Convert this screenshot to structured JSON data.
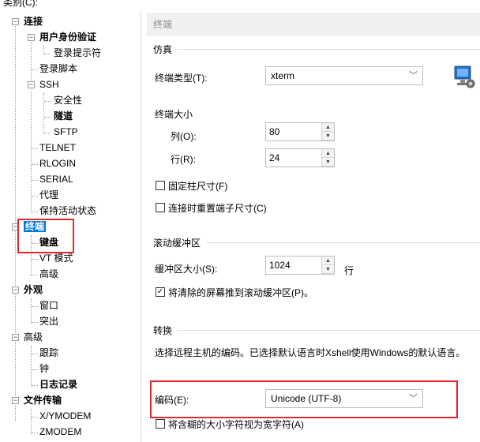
{
  "category_label": "类别(C):",
  "tree": {
    "connection": "连接",
    "user_auth": "用户身份验证",
    "login_prompt": "登录提示符",
    "login_script": "登录脚本",
    "ssh": "SSH",
    "security": "安全性",
    "tunnel": "隧道",
    "sftp": "SFTP",
    "telnet": "TELNET",
    "rlogin": "RLOGIN",
    "serial": "SERIAL",
    "proxy": "代理",
    "keepalive": "保持活动状态",
    "terminal": "终端",
    "keyboard": "键盘",
    "vt_mode": "VT 模式",
    "advanced1": "高级",
    "appearance": "外观",
    "window": "窗口",
    "highlight": "突出",
    "advanced": "高级",
    "trace": "跟踪",
    "bell": "钟",
    "log": "日志记录",
    "file_transfer": "文件传输",
    "xymodem": "X/YMODEM",
    "zmodem": "ZMODEM"
  },
  "panel": {
    "header": "终端",
    "emulation_title": "仿真",
    "terminal_type_label": "终端类型(T):",
    "terminal_type_value": "xterm",
    "terminal_size_title": "终端大小",
    "cols_label": "列(O):",
    "cols_value": "80",
    "rows_label": "行(R):",
    "rows_value": "24",
    "fixed_size_label": "固定柱尺寸(F)",
    "reset_size_label": "连接时重置端子尺寸(C)",
    "scroll_title": "滚动缓冲区",
    "buffer_size_label": "缓冲区大小(S):",
    "buffer_size_value": "1024",
    "buffer_unit": "行",
    "push_cleared_label": "将清除的屏幕推到滚动缓冲区(P)。",
    "push_cleared_checked": true,
    "conversion_title": "转换",
    "conversion_desc": "选择远程主机的编码。已选择默认语言时Xshell使用Windows的默认语言。",
    "encoding_label": "编码(E):",
    "encoding_value": "Unicode (UTF-8)",
    "ambiguous_label": "将含糊的大小字符视为宽字符(A)"
  },
  "colors": {
    "highlight_box": "#e0282e",
    "selection": "#0078d7"
  }
}
